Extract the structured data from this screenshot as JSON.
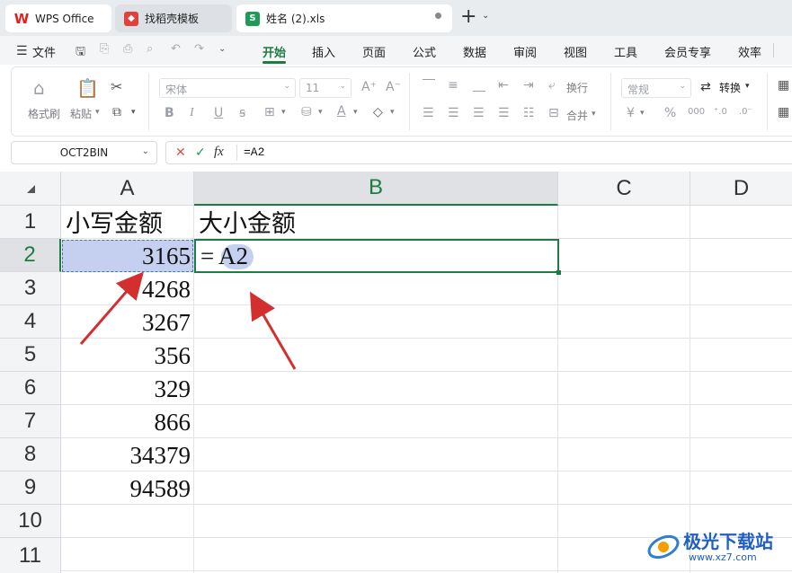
{
  "tabs": [
    {
      "label": "WPS Office",
      "icon": "wps-logo-icon"
    },
    {
      "label": "找稻壳模板",
      "icon": "docer-icon"
    },
    {
      "label": "姓名 (2).xls",
      "icon": "spreadsheet-icon"
    }
  ],
  "new_tab_label": "+",
  "menu": {
    "file": "文件",
    "items": [
      "开始",
      "插入",
      "页面",
      "公式",
      "数据",
      "审阅",
      "视图",
      "工具",
      "会员专享",
      "效率"
    ]
  },
  "ribbon": {
    "format_painter": "格式刷",
    "paste": "粘贴",
    "font_name": "宋体",
    "font_size": "11",
    "wrap_text": "换行",
    "merge": "合并",
    "number_format": "常规",
    "convert": "转换"
  },
  "formula_bar": {
    "name_box": "OCT2BIN",
    "fx": "fx",
    "content": "=A2"
  },
  "columns": [
    "A",
    "B",
    "C",
    "D"
  ],
  "rows": [
    "1",
    "2",
    "3",
    "4",
    "5",
    "6",
    "7",
    "8",
    "9",
    "10",
    "11"
  ],
  "cells": {
    "A1": "小写金额",
    "B1": "大小金额",
    "A_values": [
      "3165",
      "4268",
      "3267",
      "356",
      "329",
      "866",
      "34379",
      "94589"
    ],
    "B2_eq": "=",
    "B2_ref": "A2"
  },
  "watermark": {
    "text": "极光下载站",
    "url": "www.xz7.com"
  },
  "colors": {
    "accent_green": "#1e7b43",
    "selection": "#c5d0f0",
    "arrow": "#d32f2f"
  }
}
